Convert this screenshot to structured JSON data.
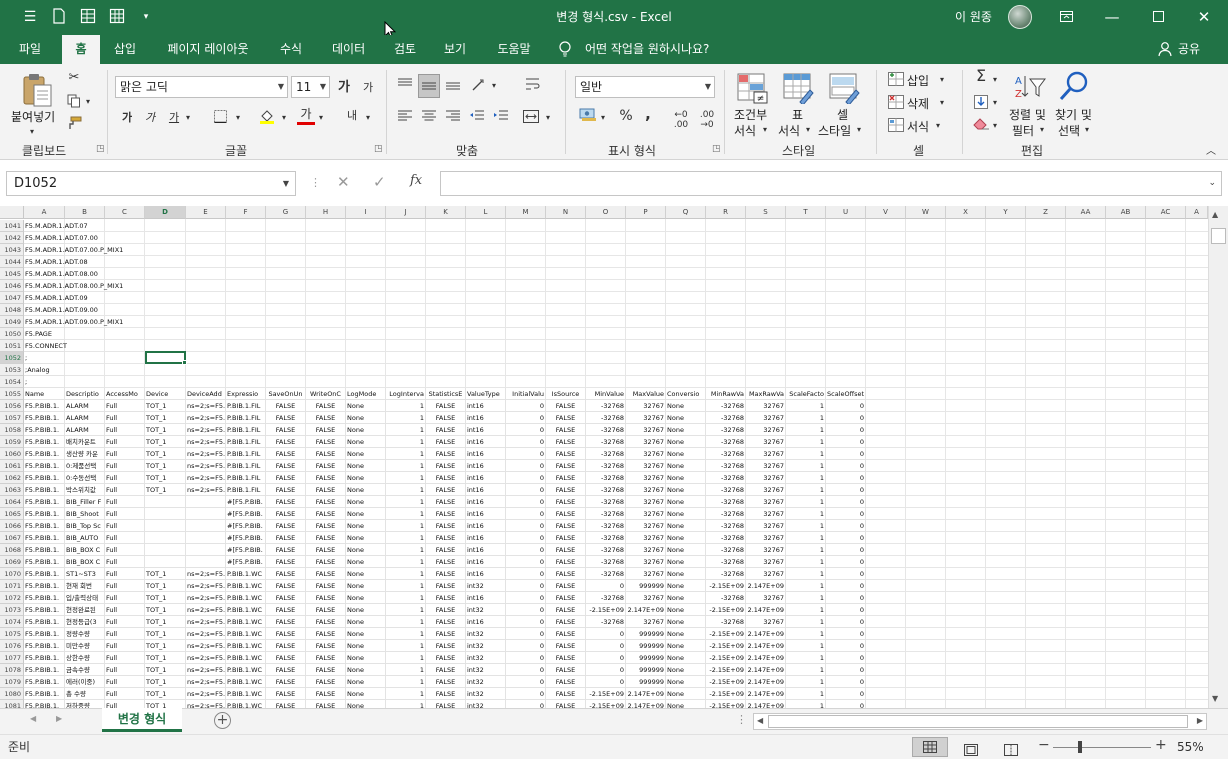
{
  "titlebar": {
    "title": "변경 형식.csv  -  Excel",
    "user": "이 원종"
  },
  "tabs": [
    "파일",
    "홈",
    "삽입",
    "페이지 레이아웃",
    "수식",
    "데이터",
    "검토",
    "보기",
    "도움말"
  ],
  "tell_me": "어떤 작업을 원하시나요?",
  "share": "공유",
  "ribbon": {
    "paste": "붙여넣기",
    "font_name": "맑은 고딕",
    "font_size": "11",
    "bold": "가",
    "italic": "가",
    "underline": "가",
    "font_color_glyph": "가",
    "wrap_glyph": "내",
    "number_format": "일반",
    "percent": "%",
    "cond_format_1": "조건부",
    "cond_format_2": "서식",
    "table_1": "표",
    "table_2": "서식",
    "cell_style_1": "셀",
    "cell_style_2": "스타일",
    "insert": "삽입",
    "delete": "삭제",
    "format": "서식",
    "sort_1": "정렬 및",
    "sort_2": "필터",
    "find_1": "찾기 및",
    "find_2": "선택",
    "groups": {
      "clipboard": "클립보드",
      "font": "글꼴",
      "alignment": "맞춤",
      "number": "표시 형식",
      "styles": "스타일",
      "cells": "셀",
      "editing": "편집"
    }
  },
  "formula": {
    "name_box": "D1052",
    "fx": "fx",
    "content": ""
  },
  "grid": {
    "columns": [
      "A",
      "B",
      "C",
      "D",
      "E",
      "F",
      "G",
      "H",
      "I",
      "J",
      "K",
      "L",
      "M",
      "N",
      "O",
      "P",
      "Q",
      "R",
      "S",
      "T",
      "U",
      "V",
      "W",
      "X",
      "Y",
      "Z",
      "AA",
      "AB",
      "AC",
      "A"
    ],
    "rows": [
      {
        "n": "1041",
        "c": [
          "F5.M.ADR.1.ADT.07"
        ]
      },
      {
        "n": "1042",
        "c": [
          "F5.M.ADR.1.ADT.07.00"
        ]
      },
      {
        "n": "1043",
        "c": [
          "F5.M.ADR.1.ADT.07.00.P_MIX1"
        ]
      },
      {
        "n": "1044",
        "c": [
          "F5.M.ADR.1.ADT.08"
        ]
      },
      {
        "n": "1045",
        "c": [
          "F5.M.ADR.1.ADT.08.00"
        ]
      },
      {
        "n": "1046",
        "c": [
          "F5.M.ADR.1.ADT.08.00.P_MIX1"
        ]
      },
      {
        "n": "1047",
        "c": [
          "F5.M.ADR.1.ADT.09"
        ]
      },
      {
        "n": "1048",
        "c": [
          "F5.M.ADR.1.ADT.09.00"
        ]
      },
      {
        "n": "1049",
        "c": [
          "F5.M.ADR.1.ADT.09.00.P_MIX1"
        ]
      },
      {
        "n": "1050",
        "c": [
          "F5.PAGE"
        ]
      },
      {
        "n": "1051",
        "c": [
          "F5.CONNECT"
        ]
      },
      {
        "n": "1052",
        "c": [
          ";"
        ]
      },
      {
        "n": "1053",
        "c": [
          ";Analog"
        ]
      },
      {
        "n": "1054",
        "c": [
          ";"
        ]
      },
      {
        "n": "1055",
        "c": [
          "Name",
          "Descriptio",
          "AccessMo",
          "Device",
          "DeviceAdd",
          "Expressio",
          "SaveOnUn",
          "WriteOnC",
          "LogMode",
          "LogInterva",
          "StatisticsE",
          "ValueType",
          "InitialValu",
          "IsSource",
          "MinValue",
          "MaxValue",
          "Conversio",
          "MinRawVa",
          "MaxRawVa",
          "ScaleFacto",
          "ScaleOffset"
        ]
      },
      {
        "n": "1056",
        "c": [
          "F5.P.BIB.1.",
          "ALARM",
          "Full",
          "TOT_1",
          "ns=2;s=F5.",
          "P.BIB.1.FIL",
          "FALSE",
          "FALSE",
          "None",
          "1",
          "FALSE",
          "int16",
          "0",
          "FALSE",
          "-32768",
          "32767",
          "None",
          "-32768",
          "32767",
          "1",
          "0"
        ]
      },
      {
        "n": "1057",
        "c": [
          "F5.P.BIB.1.",
          "ALARM",
          "Full",
          "TOT_1",
          "ns=2;s=F5.",
          "P.BIB.1.FIL",
          "FALSE",
          "FALSE",
          "None",
          "1",
          "FALSE",
          "int16",
          "0",
          "FALSE",
          "-32768",
          "32767",
          "None",
          "-32768",
          "32767",
          "1",
          "0"
        ]
      },
      {
        "n": "1058",
        "c": [
          "F5.P.BIB.1.",
          "ALARM",
          "Full",
          "TOT_1",
          "ns=2;s=F5.",
          "P.BIB.1.FIL",
          "FALSE",
          "FALSE",
          "None",
          "1",
          "FALSE",
          "int16",
          "0",
          "FALSE",
          "-32768",
          "32767",
          "None",
          "-32768",
          "32767",
          "1",
          "0"
        ]
      },
      {
        "n": "1059",
        "c": [
          "F5.P.BIB.1.",
          "배치카운트",
          "Full",
          "TOT_1",
          "ns=2;s=F5.",
          "P.BIB.1.FIL",
          "FALSE",
          "FALSE",
          "None",
          "1",
          "FALSE",
          "int16",
          "0",
          "FALSE",
          "-32768",
          "32767",
          "None",
          "-32768",
          "32767",
          "1",
          "0"
        ]
      },
      {
        "n": "1060",
        "c": [
          "F5.P.BIB.1.",
          "생산량 카운",
          "Full",
          "TOT_1",
          "ns=2;s=F5.",
          "P.BIB.1.FIL",
          "FALSE",
          "FALSE",
          "None",
          "1",
          "FALSE",
          "int16",
          "0",
          "FALSE",
          "-32768",
          "32767",
          "None",
          "-32768",
          "32767",
          "1",
          "0"
        ]
      },
      {
        "n": "1061",
        "c": [
          "F5.P.BIB.1.",
          "0:제품선택",
          "Full",
          "TOT_1",
          "ns=2;s=F5.",
          "P.BIB.1.FIL",
          "FALSE",
          "FALSE",
          "None",
          "1",
          "FALSE",
          "int16",
          "0",
          "FALSE",
          "-32768",
          "32767",
          "None",
          "-32768",
          "32767",
          "1",
          "0"
        ]
      },
      {
        "n": "1062",
        "c": [
          "F5.P.BIB.1.",
          "0:수동선택",
          "Full",
          "TOT_1",
          "ns=2;s=F5.",
          "P.BIB.1.FIL",
          "FALSE",
          "FALSE",
          "None",
          "1",
          "FALSE",
          "int16",
          "0",
          "FALSE",
          "-32768",
          "32767",
          "None",
          "-32768",
          "32767",
          "1",
          "0"
        ]
      },
      {
        "n": "1063",
        "c": [
          "F5.P.BIB.1.",
          "박스위치값",
          "Full",
          "TOT_1",
          "ns=2;s=F5.",
          "P.BIB.1.FIL",
          "FALSE",
          "FALSE",
          "None",
          "1",
          "FALSE",
          "int16",
          "0",
          "FALSE",
          "-32768",
          "32767",
          "None",
          "-32768",
          "32767",
          "1",
          "0"
        ]
      },
      {
        "n": "1064",
        "c": [
          "F5.P.BIB.1.",
          "BIB_Filler F",
          "Full",
          "",
          "",
          "#[F5.P.BIB.",
          "FALSE",
          "FALSE",
          "None",
          "1",
          "FALSE",
          "int16",
          "0",
          "FALSE",
          "-32768",
          "32767",
          "None",
          "-32768",
          "32767",
          "1",
          "0"
        ]
      },
      {
        "n": "1065",
        "c": [
          "F5.P.BIB.1.",
          "BIB_Shoot",
          "Full",
          "",
          "",
          "#[F5.P.BIB.",
          "FALSE",
          "FALSE",
          "None",
          "1",
          "FALSE",
          "int16",
          "0",
          "FALSE",
          "-32768",
          "32767",
          "None",
          "-32768",
          "32767",
          "1",
          "0"
        ]
      },
      {
        "n": "1066",
        "c": [
          "F5.P.BIB.1.",
          "BIB_Top Sc",
          "Full",
          "",
          "",
          "#[F5.P.BIB.",
          "FALSE",
          "FALSE",
          "None",
          "1",
          "FALSE",
          "int16",
          "0",
          "FALSE",
          "-32768",
          "32767",
          "None",
          "-32768",
          "32767",
          "1",
          "0"
        ]
      },
      {
        "n": "1067",
        "c": [
          "F5.P.BIB.1.",
          "BIB_AUTO",
          "Full",
          "",
          "",
          "#[F5.P.BIB.",
          "FALSE",
          "FALSE",
          "None",
          "1",
          "FALSE",
          "int16",
          "0",
          "FALSE",
          "-32768",
          "32767",
          "None",
          "-32768",
          "32767",
          "1",
          "0"
        ]
      },
      {
        "n": "1068",
        "c": [
          "F5.P.BIB.1.",
          "BIB_BOX C",
          "Full",
          "",
          "",
          "#[F5.P.BIB.",
          "FALSE",
          "FALSE",
          "None",
          "1",
          "FALSE",
          "int16",
          "0",
          "FALSE",
          "-32768",
          "32767",
          "None",
          "-32768",
          "32767",
          "1",
          "0"
        ]
      },
      {
        "n": "1069",
        "c": [
          "F5.P.BIB.1.",
          "BIB_BOX C",
          "Full",
          "",
          "",
          "#[F5.P.BIB.",
          "FALSE",
          "FALSE",
          "None",
          "1",
          "FALSE",
          "int16",
          "0",
          "FALSE",
          "-32768",
          "32767",
          "None",
          "-32768",
          "32767",
          "1",
          "0"
        ]
      },
      {
        "n": "1070",
        "c": [
          "F5.P.BIB.1.",
          "ST1~ST3",
          "Full",
          "TOT_1",
          "ns=2;s=F5.",
          "P.BIB.1.WC",
          "FALSE",
          "FALSE",
          "None",
          "1",
          "FALSE",
          "int16",
          "0",
          "FALSE",
          "-32768",
          "32767",
          "None",
          "-32768",
          "32767",
          "1",
          "0"
        ]
      },
      {
        "n": "1071",
        "c": [
          "F5.P.BIB.1.",
          "현재 회번",
          "Full",
          "TOT_1",
          "ns=2;s=F5.",
          "P.BIB.1.WC",
          "FALSE",
          "FALSE",
          "None",
          "1",
          "FALSE",
          "int32",
          "0",
          "FALSE",
          "0",
          "999999",
          "None",
          "-2.15E+09",
          "2.147E+09",
          "1",
          "0"
        ]
      },
      {
        "n": "1072",
        "c": [
          "F5.P.BIB.1.",
          "입/출력상태",
          "Full",
          "TOT_1",
          "ns=2;s=F5.",
          "P.BIB.1.WC",
          "FALSE",
          "FALSE",
          "None",
          "1",
          "FALSE",
          "int16",
          "0",
          "FALSE",
          "-32768",
          "32767",
          "None",
          "-32768",
          "32767",
          "1",
          "0"
        ]
      },
      {
        "n": "1073",
        "c": [
          "F5.P.BIB.1.",
          "현정완료된",
          "Full",
          "TOT_1",
          "ns=2;s=F5.",
          "P.BIB.1.WC",
          "FALSE",
          "FALSE",
          "None",
          "1",
          "FALSE",
          "int32",
          "0",
          "FALSE",
          "-2.15E+09",
          "2.147E+09",
          "None",
          "-2.15E+09",
          "2.147E+09",
          "1",
          "0"
        ]
      },
      {
        "n": "1074",
        "c": [
          "F5.P.BIB.1.",
          "현정등급(3",
          "Full",
          "TOT_1",
          "ns=2;s=F5.",
          "P.BIB.1.WC",
          "FALSE",
          "FALSE",
          "None",
          "1",
          "FALSE",
          "int16",
          "0",
          "FALSE",
          "-32768",
          "32767",
          "None",
          "-32768",
          "32767",
          "1",
          "0"
        ]
      },
      {
        "n": "1075",
        "c": [
          "F5.P.BIB.1.",
          "정량수량",
          "Full",
          "TOT_1",
          "ns=2;s=F5.",
          "P.BIB.1.WC",
          "FALSE",
          "FALSE",
          "None",
          "1",
          "FALSE",
          "int32",
          "0",
          "FALSE",
          "0",
          "999999",
          "None",
          "-2.15E+09",
          "2.147E+09",
          "1",
          "0"
        ]
      },
      {
        "n": "1076",
        "c": [
          "F5.P.BIB.1.",
          "미만수량",
          "Full",
          "TOT_1",
          "ns=2;s=F5.",
          "P.BIB.1.WC",
          "FALSE",
          "FALSE",
          "None",
          "1",
          "FALSE",
          "int32",
          "0",
          "FALSE",
          "0",
          "999999",
          "None",
          "-2.15E+09",
          "2.147E+09",
          "1",
          "0"
        ]
      },
      {
        "n": "1077",
        "c": [
          "F5.P.BIB.1.",
          "상한수량",
          "Full",
          "TOT_1",
          "ns=2;s=F5.",
          "P.BIB.1.WC",
          "FALSE",
          "FALSE",
          "None",
          "1",
          "FALSE",
          "int32",
          "0",
          "FALSE",
          "0",
          "999999",
          "None",
          "-2.15E+09",
          "2.147E+09",
          "1",
          "0"
        ]
      },
      {
        "n": "1078",
        "c": [
          "F5.P.BIB.1.",
          "금속수량",
          "Full",
          "TOT_1",
          "ns=2;s=F5.",
          "P.BIB.1.WC",
          "FALSE",
          "FALSE",
          "None",
          "1",
          "FALSE",
          "int32",
          "0",
          "FALSE",
          "0",
          "999999",
          "None",
          "-2.15E+09",
          "2.147E+09",
          "1",
          "0"
        ]
      },
      {
        "n": "1079",
        "c": [
          "F5.P.BIB.1.",
          "에러(이중)",
          "Full",
          "TOT_1",
          "ns=2;s=F5.",
          "P.BIB.1.WC",
          "FALSE",
          "FALSE",
          "None",
          "1",
          "FALSE",
          "int32",
          "0",
          "FALSE",
          "0",
          "999999",
          "None",
          "-2.15E+09",
          "2.147E+09",
          "1",
          "0"
        ]
      },
      {
        "n": "1080",
        "c": [
          "F5.P.BIB.1.",
          "총 수량",
          "Full",
          "TOT_1",
          "ns=2;s=F5.",
          "P.BIB.1.WC",
          "FALSE",
          "FALSE",
          "None",
          "1",
          "FALSE",
          "int32",
          "0",
          "FALSE",
          "-2.15E+09",
          "2.147E+09",
          "None",
          "-2.15E+09",
          "2.147E+09",
          "1",
          "0"
        ]
      },
      {
        "n": "1081",
        "c": [
          "F5.P.BIB.1.",
          "저하중량",
          "Full",
          "TOT_1",
          "ns=2;s=F5.",
          "P.BIB.1.WC",
          "FALSE",
          "FALSE",
          "None",
          "1",
          "FALSE",
          "int32",
          "0",
          "FALSE",
          "-2.15E+09",
          "2.147E+09",
          "None",
          "-2.15E+09",
          "2.147E+09",
          "1",
          "0"
        ]
      }
    ]
  },
  "sheet": {
    "active_tab": "변경 형식"
  },
  "status": {
    "ready": "준비",
    "zoom": "55%",
    "zoom_level": 0.55
  },
  "colors": {
    "accent": "#217346",
    "selection": "#217346"
  }
}
